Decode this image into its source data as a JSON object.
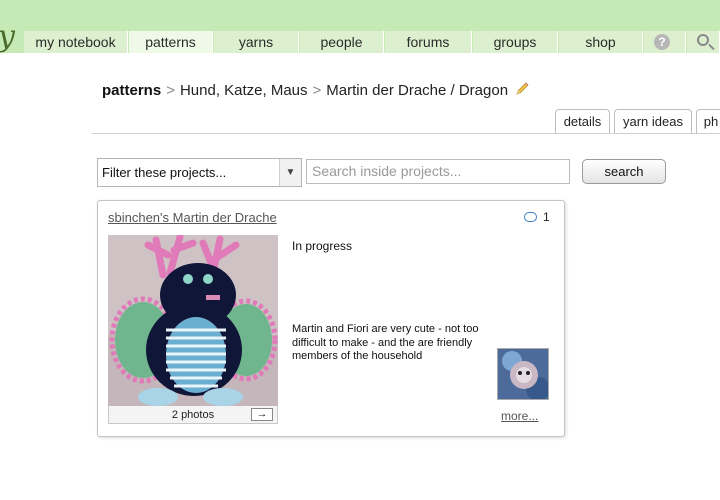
{
  "logo": {
    "text": "y"
  },
  "nav": {
    "tabs": [
      {
        "label": "my notebook"
      },
      {
        "label": "patterns"
      },
      {
        "label": "yarns"
      },
      {
        "label": "people"
      },
      {
        "label": "forums"
      },
      {
        "label": "groups"
      },
      {
        "label": "shop"
      }
    ],
    "help_icon": "help-icon",
    "search_icon": "search-icon",
    "help_glyph": "?"
  },
  "breadcrumb": {
    "root": "patterns",
    "separator": ">",
    "designer": "Hund, Katze, Maus",
    "pattern": "Martin der Drache / Dragon"
  },
  "subtabs": [
    {
      "label": "details"
    },
    {
      "label": "yarn ideas"
    },
    {
      "label": "ph"
    }
  ],
  "filter": {
    "selected": "Filter these projects...",
    "arrow": "▼"
  },
  "search": {
    "placeholder": "Search inside projects...",
    "button_label": "search"
  },
  "project": {
    "title": "sbinchen's Martin der Drache",
    "comment_count": "1",
    "status": "In progress",
    "description": "Martin and Fiori are very cute - not too difficult to make - and the are friendly members of the household",
    "photos_label": "2 photos",
    "next_glyph": "→",
    "more_label": "more..."
  },
  "colors": {
    "nav_bg": "#c6eab5",
    "tab_bg": "#dcf0d0",
    "tab_active": "#eef9e8",
    "comment_icon": "#3b7fc4"
  }
}
